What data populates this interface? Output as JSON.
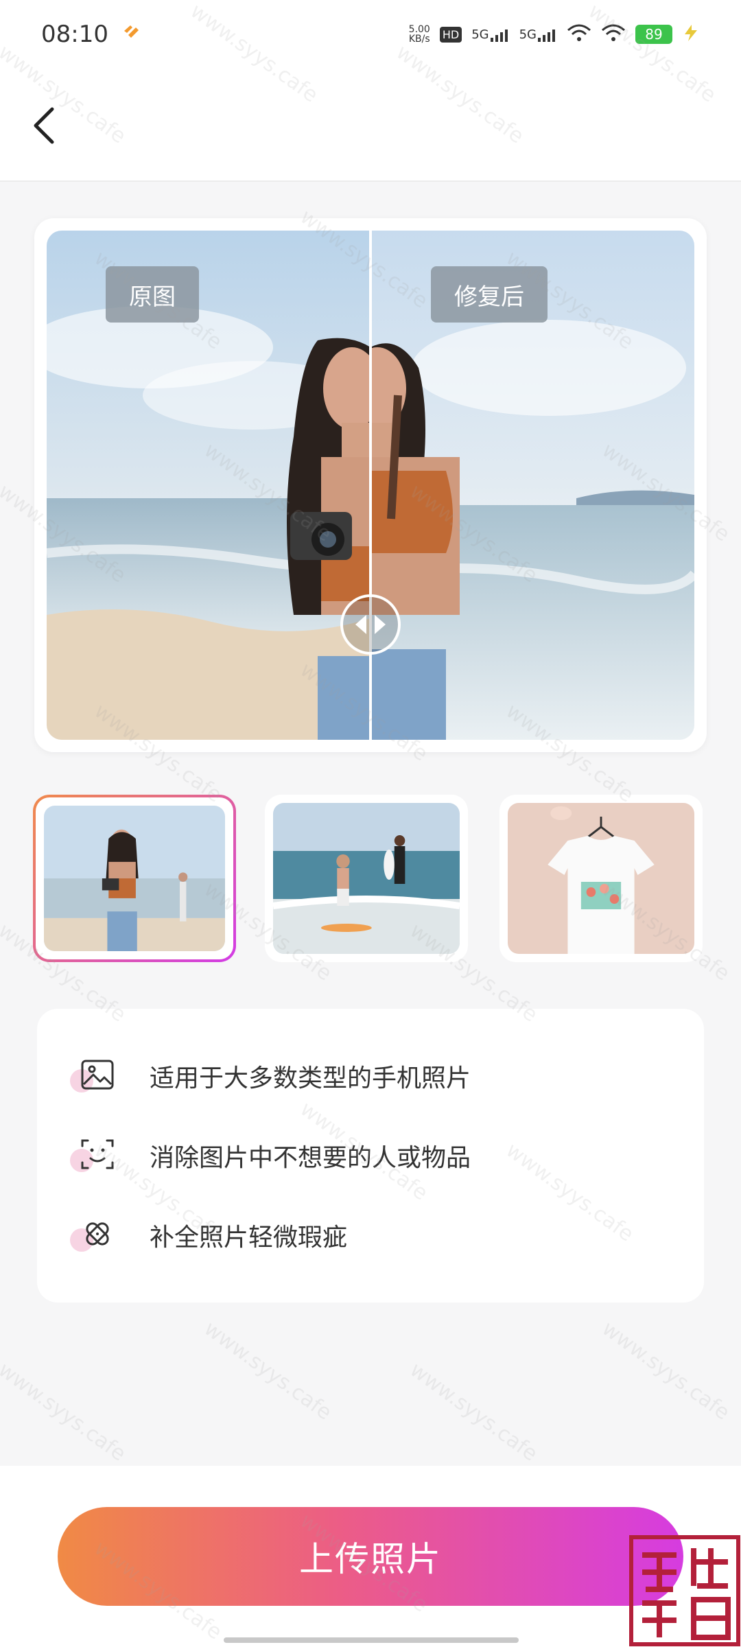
{
  "status_bar": {
    "time": "08:10",
    "net_speed_value": "5.00",
    "net_speed_unit": "KB/s",
    "hd_label": "HD",
    "sig1_label": "5G",
    "sig2_label": "5G",
    "battery": "89"
  },
  "compare": {
    "before_label": "原图",
    "after_label": "修复后"
  },
  "features": [
    {
      "text": "适用于大多数类型的手机照片"
    },
    {
      "text": "消除图片中不想要的人或物品"
    },
    {
      "text": "补全照片轻微瑕疵"
    }
  ],
  "upload_button": {
    "label": "上传照片"
  },
  "watermark": {
    "text": "www.syys.cafe"
  },
  "colors": {
    "accent_start": "#f08a45",
    "accent_end": "#d63ce0",
    "battery": "#3cc34b"
  }
}
